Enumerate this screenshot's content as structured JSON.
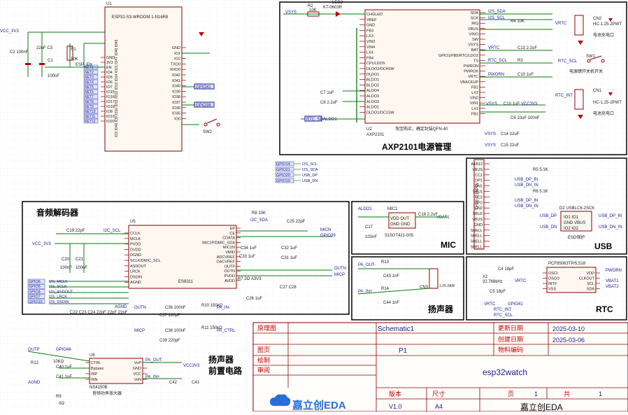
{
  "chips": {
    "esp32": {
      "ref": "U1",
      "part": "ESP32-S3-WROOM-1-N16R8",
      "left_pins": [
        "GND",
        "3V3",
        "EN",
        "IO4",
        "IO5",
        "IO6",
        "IO7",
        "IO15",
        "IO16",
        "IO17",
        "IO18",
        "IO8",
        "IO19",
        "IO20"
      ],
      "right_pins": [
        "GND",
        "IO1",
        "IO2",
        "TXD0",
        "RXD0",
        "IO42",
        "IO41",
        "IO40",
        "IO39",
        "IO38",
        "IO37",
        "IO36",
        "IO35",
        "IO0"
      ],
      "bottom_pins": "IO3 IO46 IO9 IO10 IO11 IO12 IO13 IO14 IO21 IO47 IO48 IO45",
      "left_nets": [
        "ESP_EN",
        "NET1",
        "NET2",
        "NET3",
        "NET4",
        "NET5",
        "NET6",
        "NET7",
        "NET8",
        "NET9",
        "NET10",
        "NET11",
        "NET12"
      ]
    },
    "axp": {
      "ref": "U2",
      "part": "AXP2101",
      "left_pins": [
        "CHGLED",
        "VREF",
        "GND",
        "FB3",
        "LX3",
        "VIN3",
        "VIN4",
        "LX4",
        "FB4",
        "CPULDOS",
        "DLDO2/DC4SW",
        "DLDO1",
        "BLDO1",
        "BLDO2",
        "ALDO4",
        "ALDO3",
        "ALDO2",
        "ALDO1",
        "DLDO1/DC1SW"
      ],
      "right_pins": [
        "SDA",
        "SCK",
        "IRQ",
        "VBUS",
        "VINO",
        "SW",
        "VSYS",
        "BAT",
        "GPIO1/FB5/RTC/LDO2",
        "TS",
        "PWRON",
        "PWROK",
        "VRTC",
        "VBACKUP",
        "FB2",
        "LX2",
        "VIN2",
        "VIN1",
        "LX1",
        "FB1"
      ],
      "note": "淘宝购买，确定封装QFN-40"
    },
    "codec": {
      "ref": "U5",
      "part": "ES8311",
      "left_pins": [
        "CCLK",
        "MCLK",
        "PVDD",
        "DVDD",
        "DGND",
        "SCLK/DMIC_SCL",
        "ASDOUT",
        "LRCK",
        "DSDIN",
        "AGND"
      ],
      "right_pins": [
        "EP",
        "CE",
        "CDATA",
        "MIC1P/DMIC_SDA",
        "MIC1N",
        "VMID",
        "ADCVREF",
        "DACVREF",
        "OUTP",
        "OUTN",
        "PVDD",
        "AVDD"
      ]
    },
    "amp": {
      "ref": "U6",
      "part": "NS4150B",
      "sub": "音频功率放大器",
      "left_pins": [
        "CTRL",
        "Bypass",
        "INP",
        "INN"
      ],
      "right_pins": [
        "VoP",
        "GND",
        "VCC",
        "VoN"
      ]
    },
    "mic": {
      "ref": "MIC1",
      "part": "S15OT421-005"
    },
    "rtc": {
      "ref": "U",
      "part": "PCF85063TP/5,518",
      "pins_l": [
        "OSCI",
        "OSCO",
        "INT#",
        "VSS"
      ],
      "pins_r": [
        "VDD",
        "CLKOUT",
        "SCL",
        "SDA"
      ]
    },
    "usb": {
      "ref": "USB1",
      "part": "TYPE-C16PIN",
      "pins": [
        "A1B12",
        "VBUS",
        "CC1",
        "DP1",
        "DN1",
        "SBU1",
        "CC2",
        "DP2",
        "DN2",
        "SBU2",
        "VBUS",
        "GND",
        "SHELL",
        "SHELL",
        "SHELL",
        "SHELL"
      ]
    }
  },
  "labels": {
    "axp_title": "AXP2101电源管理",
    "audio_title": "音频解码器",
    "mic_title": "MIC",
    "usb_title": "USB",
    "speaker_title": "扬声器",
    "rtc_title": "RTC",
    "spk_pre_title": "扬声器\n前置电路",
    "esd": "ESD保护",
    "cn2_caption": "电池充电口",
    "cn1_caption": "电池充电口",
    "sw1_caption": "电源键开关机开关"
  },
  "nets": [
    "VSYS",
    "VCC_3V3",
    "GPIO41",
    "GPIO38",
    "GPIO14",
    "GPIO21",
    "GPIO20",
    "GPIO19",
    "I2S_SCL",
    "I2S_SDA",
    "USB_DP",
    "USB_DN",
    "USB_DP_IN",
    "USB_DN_IN",
    "GPIO6",
    "GPIO5",
    "GPIO4",
    "GPIO7",
    "GPIO15",
    "I2S_MCLK",
    "I2S_SCLK",
    "I2S_ASDOUT",
    "I2S_LRCK",
    "I2S_DSDIN",
    "PA_OUT+",
    "PA_OUT-",
    "PA_IN+",
    "PA_IN-",
    "PA_CTRL",
    "GPIO46",
    "OUTP",
    "OUTN",
    "MICP",
    "MICN",
    "GPIO39",
    "VBAT1",
    "VBAT2",
    "PWORN",
    "VRTC",
    "RTC_INT",
    "RTC_SCL",
    "RTC_SDA",
    "ALDO1",
    "A3V3",
    "AGND",
    "VCC3V3"
  ],
  "title_block": {
    "rows": [
      {
        "k": "原理图",
        "v": "Schematic1",
        "k2": "更新日期",
        "v2": "2025-03-10"
      },
      {
        "k": "",
        "v": "",
        "k2": "创建日期",
        "v2": "2025-03-06"
      },
      {
        "k": "图页",
        "v": "P1",
        "k2": "物料编码",
        "v2": ""
      },
      {
        "k": "绘制",
        "v": "",
        "k2": "",
        "v2": ""
      },
      {
        "k": "审阅",
        "v": "esp32watch",
        "k2": "",
        "v2": ""
      }
    ],
    "footer": {
      "version_label": "版本",
      "size_label": "尺寸",
      "page_label": "页",
      "of_label": "共",
      "version": "V1.0",
      "size": "A4",
      "page": "1",
      "total": "1",
      "company": "嘉立创EDA",
      "logo": "嘉立创EDA"
    }
  },
  "colors": {
    "wire": "#0a7a0a",
    "box": "#8a0000",
    "border": "#000000",
    "label": "#1a1a8a",
    "power": "#c00000"
  }
}
